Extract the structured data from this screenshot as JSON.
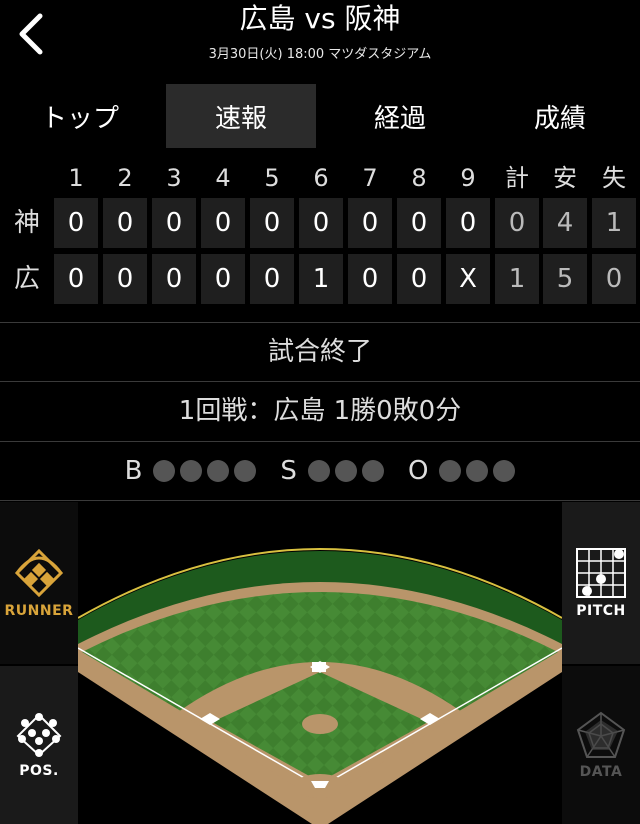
{
  "header": {
    "title": "広島 vs 阪神",
    "subtitle": "3月30日(火) 18:00 マツダスタジアム"
  },
  "tabs": [
    {
      "label": "トップ",
      "active": false
    },
    {
      "label": "速報",
      "active": true
    },
    {
      "label": "経過",
      "active": false
    },
    {
      "label": "成績",
      "active": false
    }
  ],
  "scoreboard": {
    "columns": [
      "1",
      "2",
      "3",
      "4",
      "5",
      "6",
      "7",
      "8",
      "9",
      "計",
      "安",
      "失"
    ],
    "rows": [
      {
        "team": "神",
        "cells": [
          "0",
          "0",
          "0",
          "0",
          "0",
          "0",
          "0",
          "0",
          "0",
          "0",
          "4",
          "1"
        ]
      },
      {
        "team": "広",
        "cells": [
          "0",
          "0",
          "0",
          "0",
          "0",
          "1",
          "0",
          "0",
          "X",
          "1",
          "5",
          "0"
        ]
      }
    ]
  },
  "status": "試合終了",
  "series": "1回戦：広島 1勝0敗0分",
  "count": {
    "ball_label": "B",
    "ball_dots": 4,
    "ball_on": 0,
    "strike_label": "S",
    "strike_dots": 3,
    "strike_on": 0,
    "out_label": "O",
    "out_dots": 3,
    "out_on": 0
  },
  "side_buttons": {
    "runner": "RUNNER",
    "pos": "POS.",
    "pitch": "PITCH",
    "data": "DATA"
  },
  "colors": {
    "runner_accent": "#d9a43a",
    "field_green": "#3d7d2c",
    "dirt": "#b9956a",
    "wall": "#1d5a1d"
  }
}
